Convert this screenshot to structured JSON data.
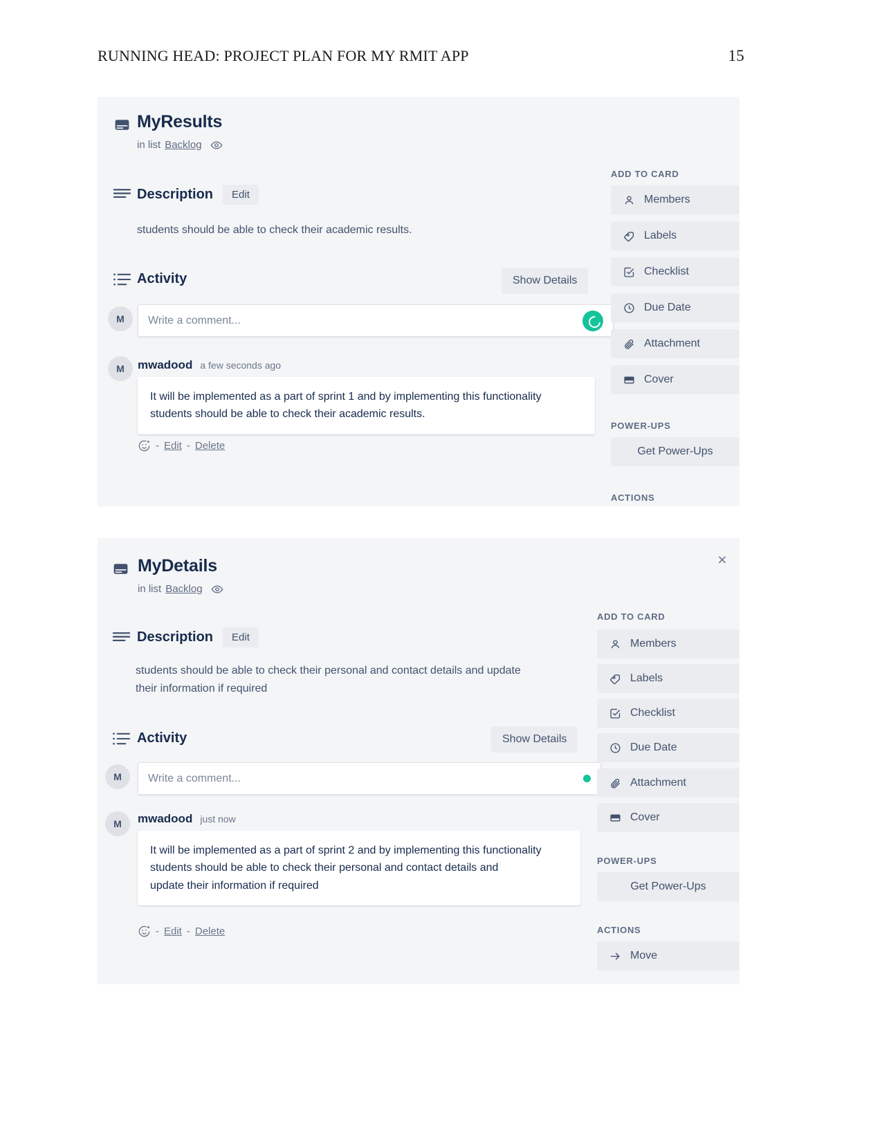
{
  "document": {
    "running_head": "RUNNING HEAD: PROJECT PLAN FOR MY RMIT APP",
    "page_number": "15"
  },
  "colors": {
    "card_background": "#f4f5f7",
    "text_primary": "#172b4d",
    "text_muted": "#5e6c84",
    "button_soft": "#ebecf0",
    "accent_green": "#15c39a"
  },
  "cards": [
    {
      "title": "MyResults",
      "list_prefix": "in list",
      "list_name": "Backlog",
      "watch_icon": "eye-icon",
      "close_label": "",
      "description": {
        "heading": "Description",
        "edit_label": "Edit",
        "text": "students should be able to check their academic results."
      },
      "activity": {
        "heading": "Activity",
        "show_details_label": "Show Details",
        "composer": {
          "avatar_initial": "M",
          "placeholder": "Write a comment...",
          "assistant_icon": "grammarly-icon"
        },
        "comments": [
          {
            "avatar_initial": "M",
            "author": "mwadood",
            "time": "a few seconds ago",
            "body": "It will be implemented as a part of sprint 1 and by implementing this functionality students should be able to check their academic results.",
            "actions": {
              "emoji_icon": "add-reaction-icon",
              "separator": "-",
              "edit_label": "Edit",
              "delete_label": "Delete"
            }
          }
        ]
      },
      "sidebar": {
        "add_to_card_heading": "ADD TO CARD",
        "add_to_card_items": [
          {
            "label": "Members",
            "icon": "person-icon"
          },
          {
            "label": "Labels",
            "icon": "tag-icon"
          },
          {
            "label": "Checklist",
            "icon": "checkbox-icon"
          },
          {
            "label": "Due Date",
            "icon": "clock-icon"
          },
          {
            "label": "Attachment",
            "icon": "paperclip-icon"
          },
          {
            "label": "Cover",
            "icon": "cover-icon"
          }
        ],
        "power_ups_heading": "POWER-UPS",
        "power_ups_items": [
          {
            "label": "Get Power-Ups",
            "icon": ""
          }
        ],
        "actions_heading": "ACTIONS",
        "actions_items": []
      }
    },
    {
      "title": "MyDetails",
      "list_prefix": "in list",
      "list_name": "Backlog",
      "watch_icon": "eye-icon",
      "close_label": "×",
      "description": {
        "heading": "Description",
        "edit_label": "Edit",
        "text": "students should be able to check their personal and contact details and update their information if required"
      },
      "activity": {
        "heading": "Activity",
        "show_details_label": "Show Details",
        "composer": {
          "avatar_initial": "M",
          "placeholder": "Write a comment...",
          "assistant_icon": "grammarly-dot-icon"
        },
        "comments": [
          {
            "avatar_initial": "M",
            "author": "mwadood",
            "time": "just now",
            "body_line_1": "It will be implemented as a part of sprint 2 and by implementing this functionality students should be able to check their personal and contact details and",
            "body_line_2": "update their information if required",
            "actions": {
              "emoji_icon": "add-reaction-icon",
              "separator": "-",
              "edit_label": "Edit",
              "delete_label": "Delete"
            }
          }
        ]
      },
      "sidebar": {
        "add_to_card_heading": "ADD TO CARD",
        "add_to_card_items": [
          {
            "label": "Members",
            "icon": "person-icon"
          },
          {
            "label": "Labels",
            "icon": "tag-icon"
          },
          {
            "label": "Checklist",
            "icon": "checkbox-icon"
          },
          {
            "label": "Due Date",
            "icon": "clock-icon"
          },
          {
            "label": "Attachment",
            "icon": "paperclip-icon"
          },
          {
            "label": "Cover",
            "icon": "cover-icon"
          }
        ],
        "power_ups_heading": "POWER-UPS",
        "power_ups_items": [
          {
            "label": "Get Power-Ups",
            "icon": ""
          }
        ],
        "actions_heading": "ACTIONS",
        "actions_items": [
          {
            "label": "Move",
            "icon": "arrow-right-icon"
          }
        ]
      }
    }
  ]
}
